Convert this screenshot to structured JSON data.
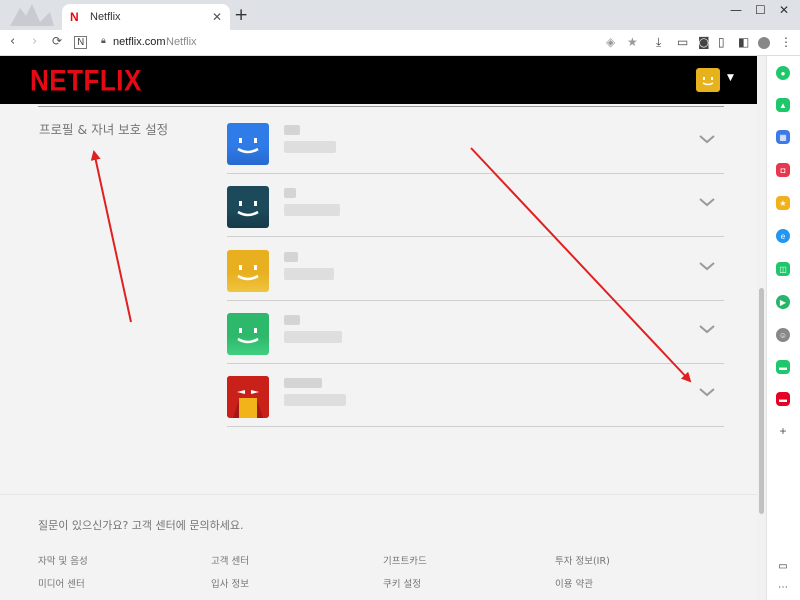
{
  "browser": {
    "tab_title": "Netflix",
    "tab_favicon": "N",
    "tab_close": "✕",
    "new_tab": "+",
    "window_controls": [
      "—",
      "☐",
      "✕"
    ],
    "url_host": "netflix.com",
    "url_title": "Netflix"
  },
  "header": {
    "logo": "NETFLIX",
    "avatar_color": "#e6b31e"
  },
  "section": {
    "label": "프로필 & 자녀 보호 설정"
  },
  "profiles": [
    {
      "avatar_color": "#2f7be8",
      "avatar_bottom": "#2769cf",
      "avatar_icon": "smile-icon"
    },
    {
      "avatar_color": "#1d4a5a",
      "avatar_bottom": "#163b48",
      "avatar_icon": "smile-icon"
    },
    {
      "avatar_color": "#e8b020",
      "avatar_bottom": "#f0c440",
      "avatar_icon": "smile-icon"
    },
    {
      "avatar_color": "#2eb86b",
      "avatar_bottom": "#3fcf80",
      "avatar_icon": "smile-icon"
    },
    {
      "avatar_color": "#d0211c",
      "avatar_bottom": "#f2b21a",
      "avatar_icon": "kids-icon"
    }
  ],
  "footer": {
    "question": "질문이 있으신가요? 고객 센터에 문의하세요.",
    "links": [
      [
        "자막 및 음성",
        "고객 센터",
        "기프트카드",
        "투자 정보(IR)"
      ],
      [
        "미디어 센터",
        "입사 정보",
        "쿠키 설정",
        "이용 약관"
      ]
    ]
  },
  "colors": {
    "netflix_red": "#e50914",
    "annotation_arrow": "#e02020"
  }
}
